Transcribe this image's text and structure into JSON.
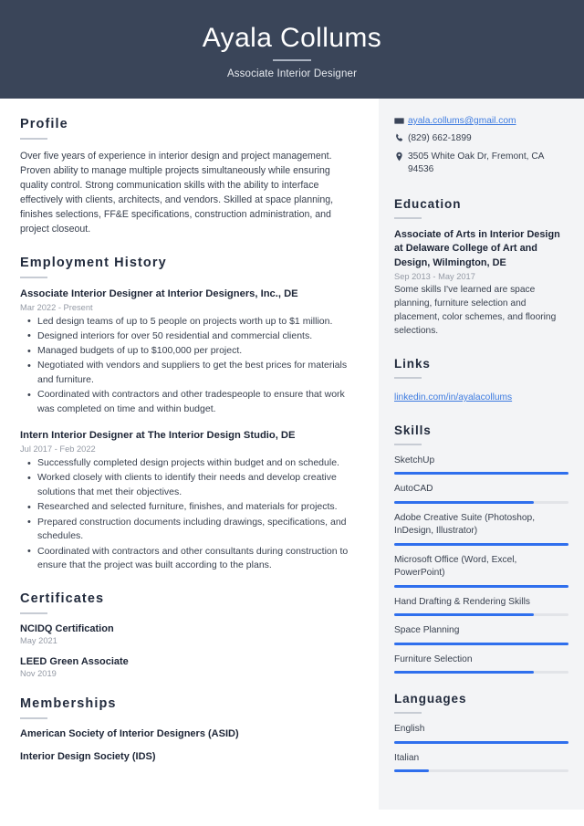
{
  "header": {
    "name": "Ayala Collums",
    "job_title": "Associate Interior Designer"
  },
  "colors": {
    "banner_bg": "#3a4559",
    "sidebar_bg": "#f3f4f6",
    "accent": "#2f6fed",
    "link": "#3d7be0",
    "heading": "#222b3d",
    "muted": "#949aa5"
  },
  "left": {
    "profile": {
      "heading": "Profile",
      "text": "Over five years of experience in interior design and project management. Proven ability to manage multiple projects simultaneously while ensuring quality control. Strong communication skills with the ability to interface effectively with clients, architects, and vendors. Skilled at space planning, finishes selections, FF&E specifications, construction administration, and project closeout."
    },
    "employment": {
      "heading": "Employment History",
      "jobs": [
        {
          "title": "Associate Interior Designer at Interior Designers, Inc., DE",
          "date": "Mar 2022 - Present",
          "bullets": [
            "Led design teams of up to 5 people on projects worth up to $1 million.",
            "Designed interiors for over 50 residential and commercial clients.",
            "Managed budgets of up to $100,000 per project.",
            "Negotiated with vendors and suppliers to get the best prices for materials and furniture.",
            "Coordinated with contractors and other tradespeople to ensure that work was completed on time and within budget."
          ]
        },
        {
          "title": "Intern Interior Designer at The Interior Design Studio, DE",
          "date": "Jul 2017 - Feb 2022",
          "bullets": [
            "Successfully completed design projects within budget and on schedule.",
            "Worked closely with clients to identify their needs and develop creative solutions that met their objectives.",
            "Researched and selected furniture, finishes, and materials for projects.",
            "Prepared construction documents including drawings, specifications, and schedules.",
            "Coordinated with contractors and other consultants during construction to ensure that the project was built according to the plans."
          ]
        }
      ]
    },
    "certificates": {
      "heading": "Certificates",
      "items": [
        {
          "name": "NCIDQ Certification",
          "date": "May 2021"
        },
        {
          "name": "LEED Green Associate",
          "date": "Nov 2019"
        }
      ]
    },
    "memberships": {
      "heading": "Memberships",
      "items": [
        "American Society of Interior Designers (ASID)",
        "Interior Design Society (IDS)"
      ]
    }
  },
  "right": {
    "contact": {
      "email": "ayala.collums@gmail.com",
      "phone": "(829) 662-1899",
      "address": "3505 White Oak Dr, Fremont, CA 94536",
      "email_icon": "envelope-icon",
      "phone_icon": "phone-icon",
      "address_icon": "map-pin-icon"
    },
    "education": {
      "heading": "Education",
      "items": [
        {
          "title": "Associate of Arts in Interior Design at Delaware College of Art and Design, Wilmington, DE",
          "date": "Sep 2013 - May 2017",
          "description": "Some skills I've learned are space planning, furniture selection and placement, color schemes, and flooring selections."
        }
      ]
    },
    "links": {
      "heading": "Links",
      "items": [
        {
          "label": "linkedin.com/in/ayalacollums"
        }
      ]
    },
    "skills": {
      "heading": "Skills",
      "items": [
        {
          "name": "SketchUp",
          "level": 100
        },
        {
          "name": "AutoCAD",
          "level": 80
        },
        {
          "name": "Adobe Creative Suite (Photoshop, InDesign, Illustrator)",
          "level": 100
        },
        {
          "name": "Microsoft Office (Word, Excel, PowerPoint)",
          "level": 100
        },
        {
          "name": "Hand Drafting & Rendering Skills",
          "level": 80
        },
        {
          "name": "Space Planning",
          "level": 100
        },
        {
          "name": "Furniture Selection",
          "level": 80
        }
      ]
    },
    "languages": {
      "heading": "Languages",
      "items": [
        {
          "name": "English",
          "level": 100
        },
        {
          "name": "Italian",
          "level": 20
        }
      ]
    }
  }
}
